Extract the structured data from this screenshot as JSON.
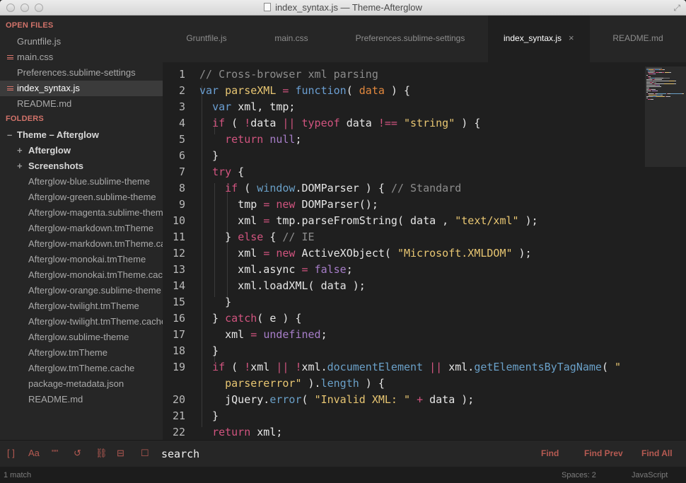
{
  "window": {
    "title": "index_syntax.js — Theme-Afterglow"
  },
  "sidebar": {
    "open_files_header": "OPEN FILES",
    "open_files": [
      {
        "label": "Gruntfile.js",
        "dirty": false,
        "active": false
      },
      {
        "label": "main.css",
        "dirty": true,
        "active": false
      },
      {
        "label": "Preferences.sublime-settings",
        "dirty": false,
        "active": false
      },
      {
        "label": "index_syntax.js",
        "dirty": true,
        "active": true
      },
      {
        "label": "README.md",
        "dirty": false,
        "active": false
      }
    ],
    "folders_header": "FOLDERS",
    "root_folder": "Theme – Afterglow",
    "subfolders": [
      "Afterglow",
      "Screenshots"
    ],
    "files": [
      "Afterglow-blue.sublime-theme",
      "Afterglow-green.sublime-theme",
      "Afterglow-magenta.sublime-theme",
      "Afterglow-markdown.tmTheme",
      "Afterglow-markdown.tmTheme.cache",
      "Afterglow-monokai.tmTheme",
      "Afterglow-monokai.tmTheme.cache",
      "Afterglow-orange.sublime-theme",
      "Afterglow-twilight.tmTheme",
      "Afterglow-twilight.tmTheme.cache",
      "Afterglow.sublime-theme",
      "Afterglow.tmTheme",
      "Afterglow.tmTheme.cache",
      "package-metadata.json",
      "README.md"
    ]
  },
  "tabs": [
    {
      "label": "Gruntfile.js",
      "active": false
    },
    {
      "label": "main.css",
      "active": false
    },
    {
      "label": "Preferences.sublime-settings",
      "active": false
    },
    {
      "label": "index_syntax.js",
      "active": true,
      "close": "×"
    },
    {
      "label": "README.md",
      "active": false
    }
  ],
  "editor": {
    "line_numbers": [
      "1",
      "2",
      "3",
      "4",
      "5",
      "6",
      "7",
      "8",
      "9",
      "10",
      "11",
      "12",
      "13",
      "14",
      "15",
      "16",
      "17",
      "18",
      "19",
      "",
      "20",
      "21",
      "22"
    ],
    "lines": [
      [
        [
          "c-comment",
          "// Cross-browser xml parsing"
        ]
      ],
      [
        [
          "c-storage",
          "var "
        ],
        [
          "c-name",
          "parseXML"
        ],
        [
          "c-kw",
          " = "
        ],
        [
          "c-func",
          "function"
        ],
        [
          "c-plain",
          "( "
        ],
        [
          "c-param",
          "data"
        ],
        [
          "c-plain",
          " ) {"
        ]
      ],
      [
        [
          "c-plain",
          "  "
        ],
        [
          "c-storage",
          "var "
        ],
        [
          "c-plain",
          "xml, tmp;"
        ]
      ],
      [
        [
          "c-plain",
          "  "
        ],
        [
          "c-kw",
          "if"
        ],
        [
          "c-plain",
          " ( "
        ],
        [
          "c-kw",
          "!"
        ],
        [
          "c-plain",
          "data "
        ],
        [
          "c-kw",
          "||"
        ],
        [
          "c-plain",
          " "
        ],
        [
          "c-kw",
          "typeof"
        ],
        [
          "c-plain",
          " data "
        ],
        [
          "c-kw",
          "!=="
        ],
        [
          "c-plain",
          " "
        ],
        [
          "c-string",
          "\"string\""
        ],
        [
          "c-plain",
          " ) {"
        ]
      ],
      [
        [
          "c-plain",
          "    "
        ],
        [
          "c-kw",
          "return "
        ],
        [
          "c-const",
          "null"
        ],
        [
          "c-plain",
          ";"
        ]
      ],
      [
        [
          "c-plain",
          "  }"
        ]
      ],
      [
        [
          "c-plain",
          "  "
        ],
        [
          "c-kw",
          "try"
        ],
        [
          "c-plain",
          " {"
        ]
      ],
      [
        [
          "c-plain",
          "    "
        ],
        [
          "c-kw",
          "if"
        ],
        [
          "c-plain",
          " ( "
        ],
        [
          "c-support",
          "window"
        ],
        [
          "c-plain",
          ".DOMParser ) { "
        ],
        [
          "c-comment",
          "// Standard"
        ]
      ],
      [
        [
          "c-plain",
          "      tmp "
        ],
        [
          "c-kw",
          "="
        ],
        [
          "c-plain",
          " "
        ],
        [
          "c-kw",
          "new"
        ],
        [
          "c-plain",
          " DOMParser();"
        ]
      ],
      [
        [
          "c-plain",
          "      xml "
        ],
        [
          "c-kw",
          "="
        ],
        [
          "c-plain",
          " tmp.parseFromString( data , "
        ],
        [
          "c-string",
          "\"text/xml\""
        ],
        [
          "c-plain",
          " );"
        ]
      ],
      [
        [
          "c-plain",
          "    } "
        ],
        [
          "c-kw",
          "else"
        ],
        [
          "c-plain",
          " { "
        ],
        [
          "c-comment",
          "// IE"
        ]
      ],
      [
        [
          "c-plain",
          "      xml "
        ],
        [
          "c-kw",
          "="
        ],
        [
          "c-plain",
          " "
        ],
        [
          "c-kw",
          "new"
        ],
        [
          "c-plain",
          " ActiveXObject( "
        ],
        [
          "c-string",
          "\"Microsoft.XMLDOM\""
        ],
        [
          "c-plain",
          " );"
        ]
      ],
      [
        [
          "c-plain",
          "      xml.async "
        ],
        [
          "c-kw",
          "="
        ],
        [
          "c-plain",
          " "
        ],
        [
          "c-const",
          "false"
        ],
        [
          "c-plain",
          ";"
        ]
      ],
      [
        [
          "c-plain",
          "      xml.loadXML( data );"
        ]
      ],
      [
        [
          "c-plain",
          "    }"
        ]
      ],
      [
        [
          "c-plain",
          "  } "
        ],
        [
          "c-kw",
          "catch"
        ],
        [
          "c-plain",
          "( e ) {"
        ]
      ],
      [
        [
          "c-plain",
          "    xml "
        ],
        [
          "c-kw",
          "="
        ],
        [
          "c-plain",
          " "
        ],
        [
          "c-const",
          "undefined"
        ],
        [
          "c-plain",
          ";"
        ]
      ],
      [
        [
          "c-plain",
          "  }"
        ]
      ],
      [
        [
          "c-plain",
          "  "
        ],
        [
          "c-kw",
          "if"
        ],
        [
          "c-plain",
          " ( "
        ],
        [
          "c-kw",
          "!"
        ],
        [
          "c-plain",
          "xml "
        ],
        [
          "c-kw",
          "||"
        ],
        [
          "c-plain",
          " "
        ],
        [
          "c-kw",
          "!"
        ],
        [
          "c-plain",
          "xml."
        ],
        [
          "c-support",
          "documentElement"
        ],
        [
          "c-plain",
          " "
        ],
        [
          "c-kw",
          "||"
        ],
        [
          "c-plain",
          " xml."
        ],
        [
          "c-support",
          "getElementsByTagName"
        ],
        [
          "c-plain",
          "( "
        ],
        [
          "c-string",
          "\""
        ]
      ],
      [
        [
          "c-plain",
          "    "
        ],
        [
          "c-string",
          "parsererror"
        ],
        [
          "c-string",
          "\""
        ],
        [
          "c-plain",
          " )."
        ],
        [
          "c-support",
          "length"
        ],
        [
          "c-plain",
          " ) {"
        ]
      ],
      [
        [
          "c-plain",
          "    jQuery."
        ],
        [
          "c-support",
          "error"
        ],
        [
          "c-plain",
          "( "
        ],
        [
          "c-string",
          "\"Invalid XML: \""
        ],
        [
          "c-plain",
          " "
        ],
        [
          "c-kw",
          "+"
        ],
        [
          "c-plain",
          " data );"
        ]
      ],
      [
        [
          "c-plain",
          "  }"
        ]
      ],
      [
        [
          "c-plain",
          "  "
        ],
        [
          "c-kw",
          "return"
        ],
        [
          "c-plain",
          " xml;"
        ]
      ]
    ]
  },
  "find": {
    "options": [
      "[ ]",
      "Aa",
      "\"\"",
      "↺",
      "⛓",
      "⊟",
      "☐"
    ],
    "query": "search",
    "find_label": "Find",
    "find_prev_label": "Find Prev",
    "find_all_label": "Find All"
  },
  "status": {
    "matches": "1 match",
    "spaces": "Spaces: 2",
    "syntax": "JavaScript"
  },
  "colors": {
    "accent": "#d2736a",
    "keyword": "#d1547f",
    "string": "#e8c672",
    "storage": "#6b9fd3",
    "constant": "#a77ec9",
    "param": "#e2883e"
  }
}
